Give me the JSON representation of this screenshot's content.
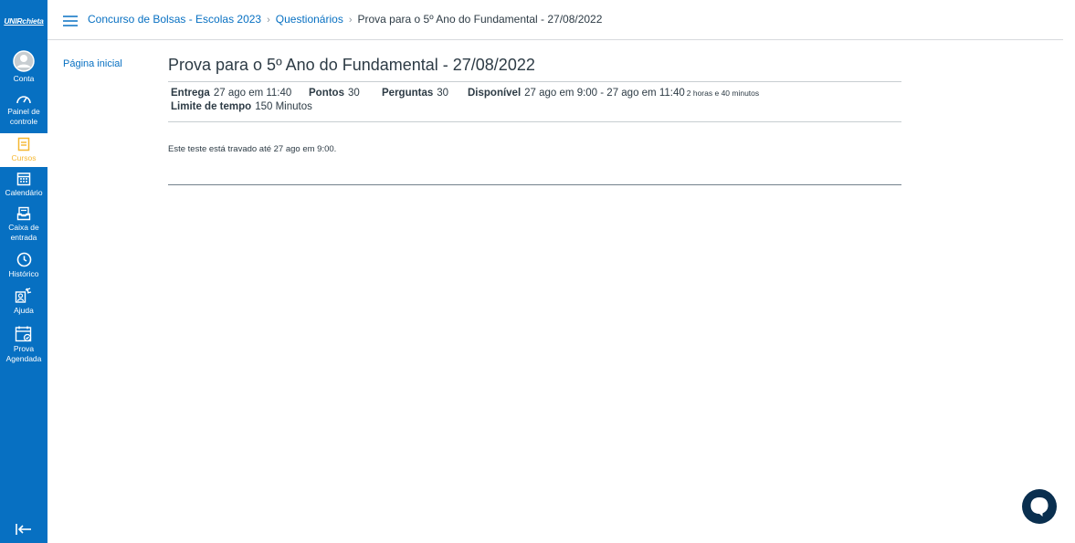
{
  "global_nav": {
    "logo": "UNIRchieta",
    "items": [
      {
        "label1": "Conta",
        "label2": "",
        "icon": "avatar-icon"
      },
      {
        "label1": "Painel de",
        "label2": "controle",
        "icon": "dashboard-icon"
      },
      {
        "label1": "Cursos",
        "label2": "",
        "icon": "courses-icon"
      },
      {
        "label1": "Calendário",
        "label2": "",
        "icon": "calendar-icon"
      },
      {
        "label1": "Caixa de",
        "label2": "entrada",
        "icon": "inbox-icon"
      },
      {
        "label1": "Histórico",
        "label2": "",
        "icon": "clock-icon"
      },
      {
        "label1": "Ajuda",
        "label2": "",
        "icon": "help-icon"
      },
      {
        "label1": "Prova",
        "label2": "Agendada",
        "icon": "calendar-check-icon"
      }
    ],
    "active_index": 2
  },
  "breadcrumb": {
    "course": "Concurso de Bolsas - Escolas 2023",
    "section": "Questionários",
    "current": "Prova para o 5º Ano do Fundamental - 27/08/2022",
    "separator": "›"
  },
  "course_nav": {
    "home": "Página inicial"
  },
  "quiz": {
    "title": "Prova para o 5º Ano do Fundamental - 27/08/2022",
    "due_label": "Entrega",
    "due_value": "27 ago em 11:40",
    "points_label": "Pontos",
    "points_value": "30",
    "questions_label": "Perguntas",
    "questions_value": "30",
    "available_label": "Disponível",
    "available_value": "27 ago em 9:00 - 27 ago em 11:40",
    "available_duration": "2 horas e 40 minutos",
    "time_limit_label": "Limite de tempo",
    "time_limit_value": "150 Minutos",
    "locked_message": "Este teste está travado até 27 ago em 9:00."
  },
  "colors": {
    "nav_bg": "#0770c2",
    "link": "#0770c2",
    "active_course": "#f5b731",
    "chat": "#0a2f4f"
  }
}
